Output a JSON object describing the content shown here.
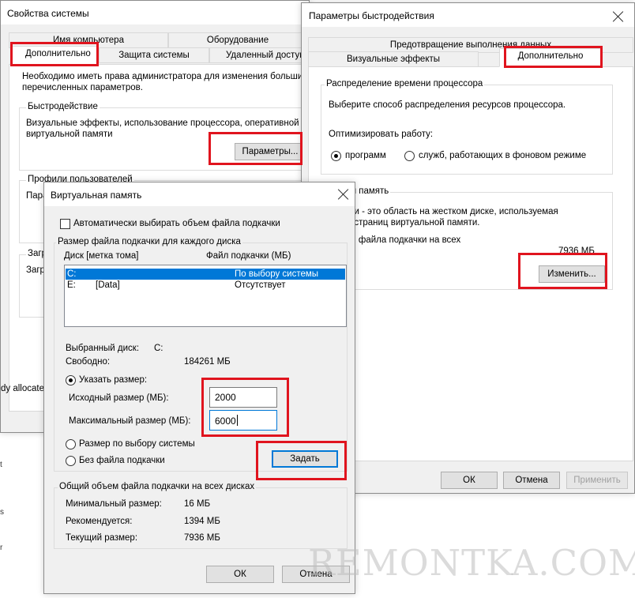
{
  "sys": {
    "title": "Свойства системы",
    "tabs_back": [
      "Имя компьютера",
      "Оборудование"
    ],
    "tabs_front": [
      "Дополнительно",
      "Защита системы",
      "Удаленный доступ"
    ],
    "admin_note_1": "Необходимо иметь права администратора для изменения большинст",
    "admin_note_2": "перечисленных параметров.",
    "perf_group": "Быстродействие",
    "perf_desc_1": "Визуальные эффекты, использование процессора, оперативной и",
    "perf_desc_2": "виртуальной памяти",
    "perf_button": "Параметры...",
    "profiles_group": "Профили пользователей",
    "profiles_desc_frag": "Пара",
    "startup_group_frag": "Загр",
    "startup_desc_frag": "Загр",
    "allocated_frag": "dy allocated"
  },
  "perf": {
    "title": "Параметры быстродействия",
    "tab_top": "Предотвращение выполнения данных",
    "tab_visual": "Визуальные эффекты",
    "tab_advanced": "Дополнительно",
    "cpu_group": "Распределение времени процессора",
    "cpu_desc": "Выберите способ распределения ресурсов процессора.",
    "optimize_label": "Оптимизировать работу:",
    "radio_programs": "программ",
    "radio_services": "служб, работающих в фоновом режиме",
    "vm_group_frag": "альная память",
    "vm_desc_1": "подкачки - это область на жестком диске, используемая",
    "vm_desc_2": "анения страниц виртуальной памяти.",
    "vm_total_label": "й объем файла подкачки на всех",
    "vm_total_label_2": "с:",
    "vm_total_value": "7936 МБ",
    "change_button": "Изменить...",
    "ok": "ОК",
    "cancel": "Отмена",
    "apply": "Применить"
  },
  "vm": {
    "title": "Виртуальная память",
    "auto_checkbox": "Автоматически выбирать объем файла подкачки",
    "per_disk_group": "Размер файла подкачки для каждого диска",
    "col_disk": "Диск [метка тома]",
    "col_file": "Файл подкачки (МБ)",
    "rows": [
      {
        "disk": "C:",
        "label": "",
        "file": "По выбору системы"
      },
      {
        "disk": "E:",
        "label": "[Data]",
        "file": "Отсутствует"
      }
    ],
    "selected_disk_label": "Выбранный диск:",
    "selected_disk_value": "C:",
    "free_label": "Свободно:",
    "free_value": "184261 МБ",
    "radio_custom": "Указать размер:",
    "initial_label": "Исходный размер (МБ):",
    "initial_value": "2000",
    "max_label": "Максимальный размер (МБ):",
    "max_value": "6000",
    "radio_system": "Размер по выбору системы",
    "radio_none": "Без файла подкачки",
    "set_button": "Задать",
    "total_group": "Общий объем файла подкачки на всех дисках",
    "min_label": "Минимальный размер:",
    "min_value": "16 МБ",
    "rec_label": "Рекомендуется:",
    "rec_value": "1394 МБ",
    "cur_label": "Текущий размер:",
    "cur_value": "7936 МБ",
    "ok": "ОК",
    "cancel": "Отмена"
  },
  "watermark": "REMONTKA.COM",
  "colors": {
    "highlight": "#e0141e",
    "selection": "#0078d7"
  }
}
